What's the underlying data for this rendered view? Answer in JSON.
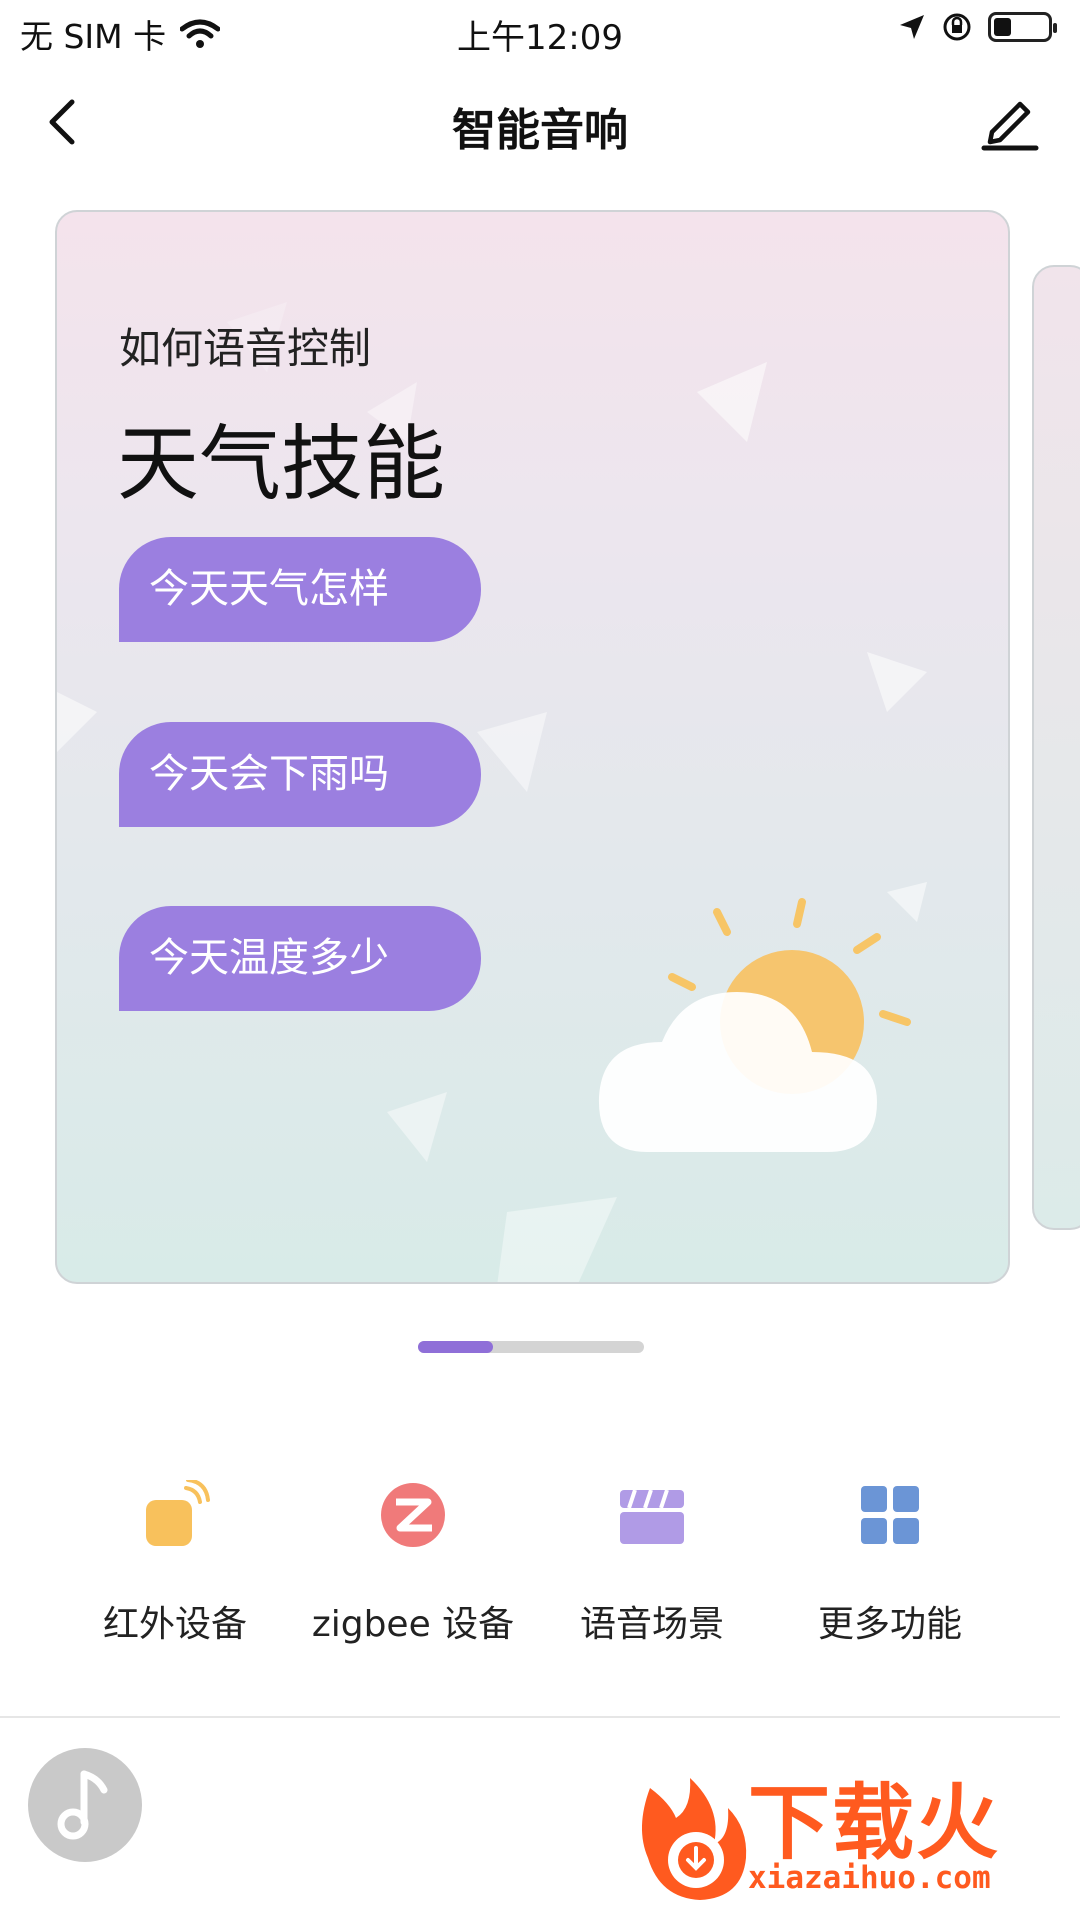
{
  "status_bar": {
    "carrier": "无 SIM 卡",
    "time": "上午12:09",
    "battery_level": 0.3
  },
  "nav": {
    "title": "智能音响",
    "back_icon": "chevron-left-icon",
    "edit_icon": "pencil-icon"
  },
  "card": {
    "subtitle": "如何语音控制",
    "title": "天气技能",
    "commands": [
      "今天天气怎样",
      "今天会下雨吗",
      "今天温度多少"
    ],
    "illustration": "sun-cloud-icon"
  },
  "pager": {
    "page": 1,
    "pages": 3
  },
  "functions": [
    {
      "label": "红外设备",
      "icon": "infrared-remote-icon",
      "color": "#f8c15c"
    },
    {
      "label": "zigbee 设备",
      "icon": "zigbee-icon",
      "color": "#f07a7a"
    },
    {
      "label": "语音场景",
      "icon": "clapperboard-icon",
      "color": "#b09be6"
    },
    {
      "label": "更多功能",
      "icon": "grid-icon",
      "color": "#6b95d6"
    }
  ],
  "bottom": {
    "music_icon": "music-note-icon"
  },
  "watermark": {
    "brand": "下载火",
    "url": "xiazaihuo.com"
  },
  "colors": {
    "accent": "#9b7fe0",
    "pager_active": "#8f6fd8",
    "watermark": "#ff5a1f"
  }
}
